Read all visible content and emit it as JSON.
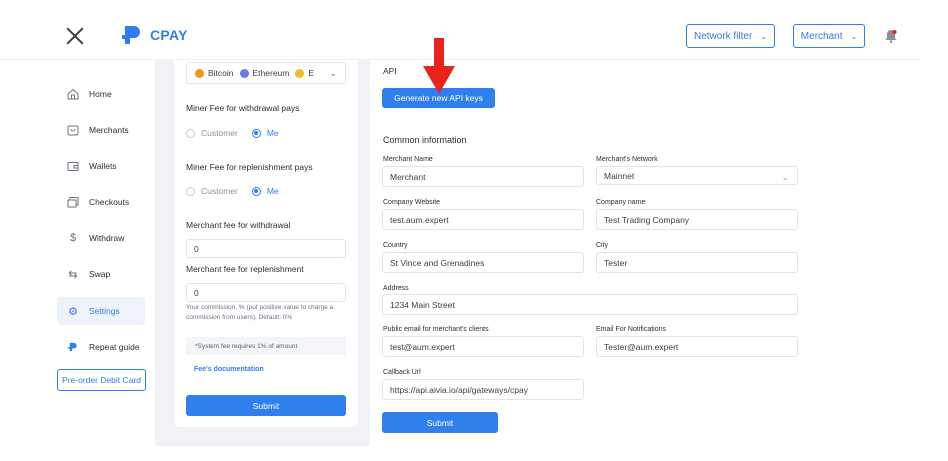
{
  "header": {
    "logo_text": "CPAY",
    "network_filter_label": "Network filter",
    "merchant_label": "Merchant"
  },
  "sidebar": {
    "items": [
      {
        "label": "Home",
        "icon": "home-icon"
      },
      {
        "label": "Merchants",
        "icon": "merchants-icon"
      },
      {
        "label": "Wallets",
        "icon": "wallet-icon"
      },
      {
        "label": "Checkouts",
        "icon": "checkout-icon"
      },
      {
        "label": "Withdraw",
        "icon": "dollar-icon"
      },
      {
        "label": "Swap",
        "icon": "swap-icon"
      },
      {
        "label": "Settings",
        "icon": "gear-icon"
      },
      {
        "label": "Repeat guide",
        "icon": "cpay-logo-icon"
      }
    ],
    "preorder_label": "Pre-order Debit Card"
  },
  "left_panel": {
    "coins": [
      {
        "name": "Bitcoin",
        "color": "#f7931a"
      },
      {
        "name": "Ethereum",
        "color": "#627eea"
      },
      {
        "name": "E",
        "color": "#f3ba2f"
      }
    ],
    "miner_fee_withdrawal": {
      "label": "Miner Fee for withdrawal pays",
      "options": [
        "Customer",
        "Me"
      ],
      "selected": "Me"
    },
    "miner_fee_replenishment": {
      "label": "Miner Fee for replenishment pays",
      "options": [
        "Customer",
        "Me"
      ],
      "selected": "Me"
    },
    "merchant_fee_withdrawal": {
      "label": "Merchant fee for withdrawal",
      "value": "0"
    },
    "merchant_fee_replenishment": {
      "label": "Merchant fee for replenishment",
      "value": "0"
    },
    "commission_hint": "Your commission, % (put positive value to charge a commission from users). Default: 0%",
    "system_fee_note": "*System fee requires 1% of amount",
    "fees_doc_link": "Fee's documentation",
    "submit_label": "Submit"
  },
  "right_panel": {
    "api_title": "API",
    "generate_keys_label": "Generate new API keys",
    "common_info_title": "Common information",
    "fields": {
      "merchant_name": {
        "label": "Merchant Name",
        "value": "Merchant"
      },
      "merchant_network": {
        "label": "Merchant's Network",
        "value": "Mainnet"
      },
      "company_website": {
        "label": "Company Website",
        "value": "test.aum.expert"
      },
      "company_name": {
        "label": "Company name",
        "value": "Test Trading Company"
      },
      "country": {
        "label": "Country",
        "value": "St Vince and Grenadines"
      },
      "city": {
        "label": "City",
        "value": "Tester"
      },
      "address": {
        "label": "Address",
        "value": "1234 Main Street"
      },
      "public_email": {
        "label": "Public email for merchant's clients",
        "value": "test@aum.expert"
      },
      "notification_email": {
        "label": "Email For Notifications",
        "value": "Tester@aum.expert"
      },
      "callback_url": {
        "label": "Callback Url",
        "value": "https://api.aivia.io/api/gateways/cpay"
      }
    },
    "submit_label": "Submit"
  },
  "colors": {
    "accent": "#2f80ed",
    "annotation_arrow": "#e8231c"
  }
}
